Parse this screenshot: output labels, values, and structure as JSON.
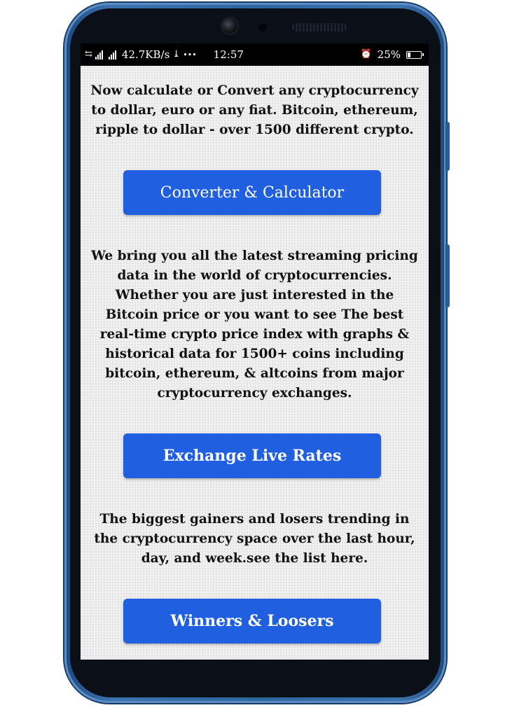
{
  "statusbar": {
    "network_speed": "42.7KB/s",
    "more_indicator": "•••",
    "time": "12:57",
    "battery_percent": "25%",
    "battery_level": 0.25,
    "icons": [
      "data-transfer-icon",
      "signal-icon",
      "download-icon",
      "alarm-icon",
      "battery-icon"
    ]
  },
  "sections": [
    {
      "text": "Now calculate or Convert any cryptocurrency to dollar, euro or any fiat. Bitcoin, ethereum, ripple to dollar - over 1500 different crypto.",
      "button": "Converter & Calculator"
    },
    {
      "text": "We bring you all the latest streaming pricing data in the world of cryptocurrencies. Whether you are just interested in the Bitcoin price or you want to see The best real-time crypto price index with graphs & historical data for 1500+ coins including bitcoin, ethereum, & altcoins from major cryptocurrency exchanges.",
      "button": "Exchange Live Rates"
    },
    {
      "text": "The biggest gainers and losers trending in the cryptocurrency space over the last hour, day, and week.see the list here.",
      "button": "Winners & Loosers"
    }
  ],
  "colors": {
    "button_bg": "#1f5fe0",
    "button_text": "#ffffff",
    "screen_bg": "#efefef",
    "phone_frame": "#2f659f"
  }
}
